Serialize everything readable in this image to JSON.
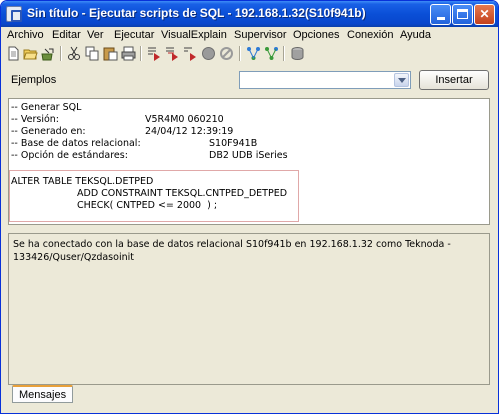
{
  "window": {
    "title": "Sin título - Ejecutar scripts de SQL - 192.168.1.32(S10f941b)"
  },
  "menu": [
    "Archivo",
    "Editar",
    "Ver",
    "Ejecutar",
    "VisualExplain",
    "Supervisor",
    "Opciones",
    "Conexión",
    "Ayuda"
  ],
  "toolbar_icons": [
    "new-file-icon",
    "open-folder-icon",
    "save-icon",
    "cut-icon",
    "copy-icon",
    "paste-icon",
    "print-icon",
    "run-all-icon",
    "run-from-cursor-icon",
    "run-statement-icon",
    "stop-icon",
    "cancel-icon",
    "visual-explain-icon",
    "run-and-explain-icon",
    "connect-icon"
  ],
  "examples": {
    "label": "Ejemplos",
    "selected": "",
    "insert_label": "Insertar"
  },
  "editor": {
    "lines": [
      "-- Generar SQL",
      "-- Versión:",
      "-- Generado en:",
      "-- Base de datos relacional:",
      "-- Opción de estándares:",
      "ALTER TABLE TEKSQL.DETPED",
      "ADD CONSTRAINT TEKSQL.CNTPED_DETPED",
      "CHECK( CNTPED <= 2000  ) ;"
    ],
    "values": {
      "version": "V5R4M0 060210",
      "generated": "24/04/12 12:39:19",
      "database": "S10F941B",
      "standards": "DB2 UDB iSeries"
    }
  },
  "messages": {
    "text": "Se ha conectado con la base de datos relacional S10f941b en 192.168.1.32 como Teknoda - 133426/Quser/Qzdasoinit",
    "tab_label": "Mensajes"
  },
  "colors": {
    "title_bar": "#0a4fd7",
    "window_bg": "#ece9d8",
    "highlight_border": "#e0a8a8",
    "tab_accent": "#e8a03a"
  }
}
